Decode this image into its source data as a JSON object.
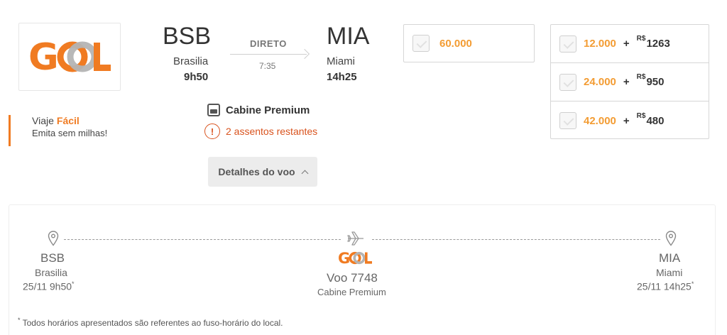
{
  "airline": {
    "logo_text": "GOL"
  },
  "promo": {
    "line1_prefix": "Viaje",
    "line1_highlight": "Fácil",
    "line2": "Emita sem milhas!"
  },
  "route": {
    "origin": {
      "code": "BSB",
      "city": "Brasilia",
      "time": "9h50"
    },
    "destination": {
      "code": "MIA",
      "city": "Miami",
      "time": "14h25"
    },
    "stops_label": "DIRETO",
    "duration": "7:35"
  },
  "cabin_label": "Cabine Premium",
  "seats_label": "2 assentos restantes",
  "details_button": "Detalhes do voo",
  "price_single": {
    "miles": "60.000"
  },
  "price_combos": [
    {
      "miles": "12.000",
      "plus": "+",
      "currency": "R$",
      "amount": "1263"
    },
    {
      "miles": "24.000",
      "plus": "+",
      "currency": "R$",
      "amount": "950"
    },
    {
      "miles": "42.000",
      "plus": "+",
      "currency": "R$",
      "amount": "480"
    }
  ],
  "itinerary": {
    "departure": {
      "code": "BSB",
      "city": "Brasilia",
      "datetime": "25/11 9h50",
      "mark": "*"
    },
    "flight": {
      "number": "Voo 7748",
      "cabin": "Cabine Premium"
    },
    "arrival": {
      "code": "MIA",
      "city": "Miami",
      "datetime": "25/11 14h25",
      "mark": "*"
    }
  },
  "footnote": {
    "mark": "*",
    "text": " Todos horários apresentados são referentes ao fuso-horário do local."
  },
  "colors": {
    "accent": "#f07b22",
    "miles": "#f39c33",
    "warning": "#d9531e",
    "logo_grey": "#b4b4b4"
  }
}
